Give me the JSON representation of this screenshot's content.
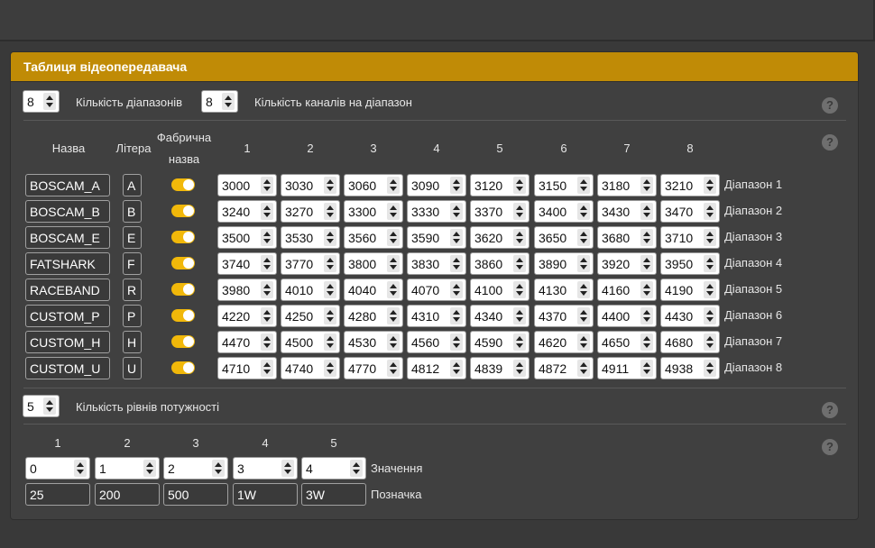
{
  "panel": {
    "title": "Таблиця відеопередавача",
    "help_glyph": "?"
  },
  "bands": {
    "count": "8",
    "count_label": "Кількість діапазонів"
  },
  "channels": {
    "count": "8",
    "count_label": "Кількість каналів на діапазон"
  },
  "table": {
    "headers": {
      "name": "Назва",
      "letter": "Літера",
      "factory_line1": "Фабрична",
      "factory_line2": "назва",
      "channels": [
        "1",
        "2",
        "3",
        "4",
        "5",
        "6",
        "7",
        "8"
      ]
    },
    "rows": [
      {
        "name": "BOSCAM_A",
        "letter": "A",
        "factory": true,
        "freqs": [
          "3000",
          "3030",
          "3060",
          "3090",
          "3120",
          "3150",
          "3180",
          "3210"
        ],
        "label": "Діапазон 1"
      },
      {
        "name": "BOSCAM_B",
        "letter": "B",
        "factory": true,
        "freqs": [
          "3240",
          "3270",
          "3300",
          "3330",
          "3370",
          "3400",
          "3430",
          "3470"
        ],
        "label": "Діапазон 2"
      },
      {
        "name": "BOSCAM_E",
        "letter": "E",
        "factory": true,
        "freqs": [
          "3500",
          "3530",
          "3560",
          "3590",
          "3620",
          "3650",
          "3680",
          "3710"
        ],
        "label": "Діапазон 3"
      },
      {
        "name": "FATSHARK",
        "letter": "F",
        "factory": true,
        "freqs": [
          "3740",
          "3770",
          "3800",
          "3830",
          "3860",
          "3890",
          "3920",
          "3950"
        ],
        "label": "Діапазон 4"
      },
      {
        "name": "RACEBAND",
        "letter": "R",
        "factory": true,
        "freqs": [
          "3980",
          "4010",
          "4040",
          "4070",
          "4100",
          "4130",
          "4160",
          "4190"
        ],
        "label": "Діапазон 5"
      },
      {
        "name": "CUSTOM_P",
        "letter": "P",
        "factory": true,
        "freqs": [
          "4220",
          "4250",
          "4280",
          "4310",
          "4340",
          "4370",
          "4400",
          "4430"
        ],
        "label": "Діапазон 6"
      },
      {
        "name": "CUSTOM_H",
        "letter": "H",
        "factory": true,
        "freqs": [
          "4470",
          "4500",
          "4530",
          "4560",
          "4590",
          "4620",
          "4650",
          "4680"
        ],
        "label": "Діапазон 7"
      },
      {
        "name": "CUSTOM_U",
        "letter": "U",
        "factory": true,
        "freqs": [
          "4710",
          "4740",
          "4770",
          "4812",
          "4839",
          "4872",
          "4911",
          "4938"
        ],
        "label": "Діапазон 8"
      }
    ]
  },
  "power": {
    "count": "5",
    "count_label": "Кількість рівнів потужності",
    "headers": [
      "1",
      "2",
      "3",
      "4",
      "5"
    ],
    "values": [
      "0",
      "1",
      "2",
      "3",
      "4"
    ],
    "values_label": "Значення",
    "labels": [
      "25",
      "200",
      "500",
      "1W",
      "3W"
    ],
    "labels_label": "Позначка"
  }
}
